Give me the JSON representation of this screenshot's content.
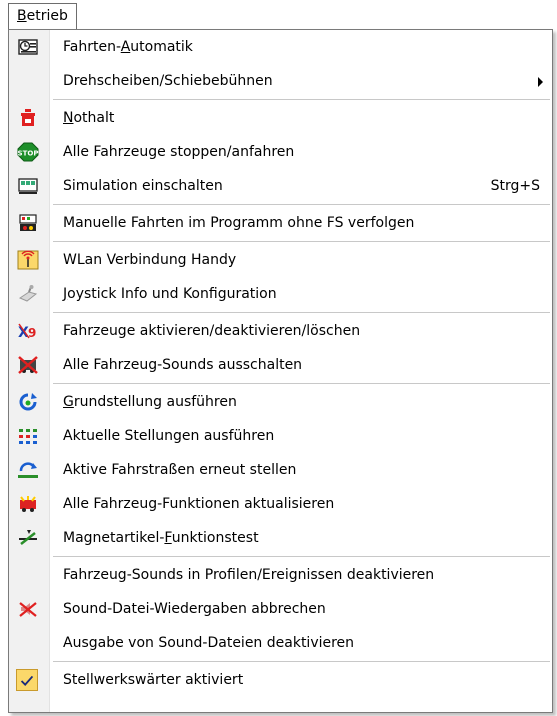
{
  "menu": {
    "title_prefix": "",
    "title_accel": "B",
    "title_rest": "etrieb"
  },
  "items": [
    {
      "pre": "Fahrten-",
      "acc": "A",
      "post": "utomatik",
      "shortcut": "",
      "icon": "auto-drive-icon"
    },
    {
      "pre": "Drehscheiben/Schiebebühnen",
      "acc": "",
      "post": "",
      "shortcut": "",
      "icon": "",
      "submenu": true
    },
    {
      "pre": "",
      "acc": "N",
      "post": "othalt",
      "shortcut": "",
      "icon": "emergency-stop-icon"
    },
    {
      "pre": "Alle Fahrzeuge stoppen/anfahren",
      "acc": "",
      "post": "",
      "shortcut": "",
      "icon": "stop-sign-icon"
    },
    {
      "pre": "Simulation einschalten",
      "acc": "",
      "post": "",
      "shortcut": "Strg+S",
      "icon": "simulation-icon"
    },
    {
      "pre": "Manuelle Fahrten im Programm ohne FS verfolgen",
      "acc": "",
      "post": "",
      "shortcut": "",
      "icon": "manual-track-icon"
    },
    {
      "pre": "WLan Verbindung Handy",
      "acc": "",
      "post": "",
      "shortcut": "",
      "icon": "wlan-antenna-icon"
    },
    {
      "pre": "",
      "acc": "J",
      "post": "oystick Info und Konfiguration",
      "shortcut": "",
      "icon": "joystick-icon"
    },
    {
      "pre": "Fahrzeuge aktivieren/deaktivieren/löschen",
      "acc": "",
      "post": "",
      "shortcut": "",
      "icon": "vehicle-toggle-icon"
    },
    {
      "pre": "Alle Fahrzeug-Sounds ausschalten",
      "acc": "",
      "post": "",
      "shortcut": "",
      "icon": "sound-off-icon"
    },
    {
      "pre": "",
      "acc": "G",
      "post": "rundstellung ausführen",
      "shortcut": "",
      "icon": "reset-icon"
    },
    {
      "pre": "Aktuelle Stellungen ausführen",
      "acc": "",
      "post": "",
      "shortcut": "",
      "icon": "switch-states-icon"
    },
    {
      "pre": "Aktive Fahrstraßen erneut stellen",
      "acc": "",
      "post": "",
      "shortcut": "",
      "icon": "route-reset-icon"
    },
    {
      "pre": "Alle Fahrzeug-Funktionen aktualisieren",
      "acc": "",
      "post": "",
      "shortcut": "",
      "icon": "functions-refresh-icon"
    },
    {
      "pre": "Magnetartikel-",
      "acc": "F",
      "post": "unktionstest",
      "shortcut": "",
      "icon": "turnout-test-icon"
    },
    {
      "pre": "Fahrzeug-Sounds in Profilen/Ereignissen deaktivieren",
      "acc": "",
      "post": "",
      "shortcut": "",
      "icon": ""
    },
    {
      "pre": "Sound-Datei-Wiedergaben abbrechen",
      "acc": "",
      "post": "",
      "shortcut": "",
      "icon": "sound-cancel-icon"
    },
    {
      "pre": "Ausgabe von Sound-Dateien deaktivieren",
      "acc": "",
      "post": "",
      "shortcut": "",
      "icon": ""
    },
    {
      "pre": "Stellwerkswärter aktiviert",
      "acc": "",
      "post": "",
      "shortcut": "",
      "icon": "checkmark-icon",
      "checked": true
    }
  ]
}
